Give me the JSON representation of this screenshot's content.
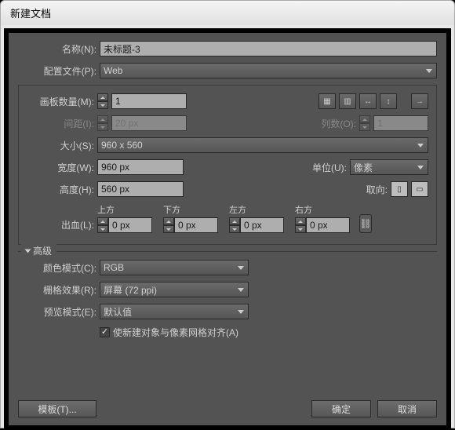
{
  "title": "新建文档",
  "name": {
    "label": "名称(N):",
    "value": "未标题-3"
  },
  "profile": {
    "label": "配置文件(P):",
    "value": "Web"
  },
  "artboards": {
    "label": "画板数量(M):",
    "value": "1"
  },
  "spacing": {
    "label": "间距(I):",
    "value": "20 px"
  },
  "cols": {
    "label": "列数(O):",
    "value": "1"
  },
  "size": {
    "label": "大小(S):",
    "value": "960 x 560"
  },
  "width": {
    "label": "宽度(W):",
    "value": "960 px"
  },
  "units": {
    "label": "单位(U):",
    "value": "像素"
  },
  "height": {
    "label": "高度(H):",
    "value": "560 px"
  },
  "orient": {
    "label": "取向:"
  },
  "bleed": {
    "label": "出血(L):",
    "top": {
      "lbl": "上方",
      "val": "0 px"
    },
    "bottom": {
      "lbl": "下方",
      "val": "0 px"
    },
    "left": {
      "lbl": "左方",
      "val": "0 px"
    },
    "right": {
      "lbl": "右方",
      "val": "0 px"
    }
  },
  "advanced": "高级",
  "colormode": {
    "label": "颜色模式(C):",
    "value": "RGB"
  },
  "raster": {
    "label": "栅格效果(R):",
    "value": "屏幕 (72 ppi)"
  },
  "preview": {
    "label": "预览模式(E):",
    "value": "默认值"
  },
  "align": "使新建对象与像素网格对齐(A)",
  "template": "模板(T)...",
  "ok": "确定",
  "cancel": "取消"
}
